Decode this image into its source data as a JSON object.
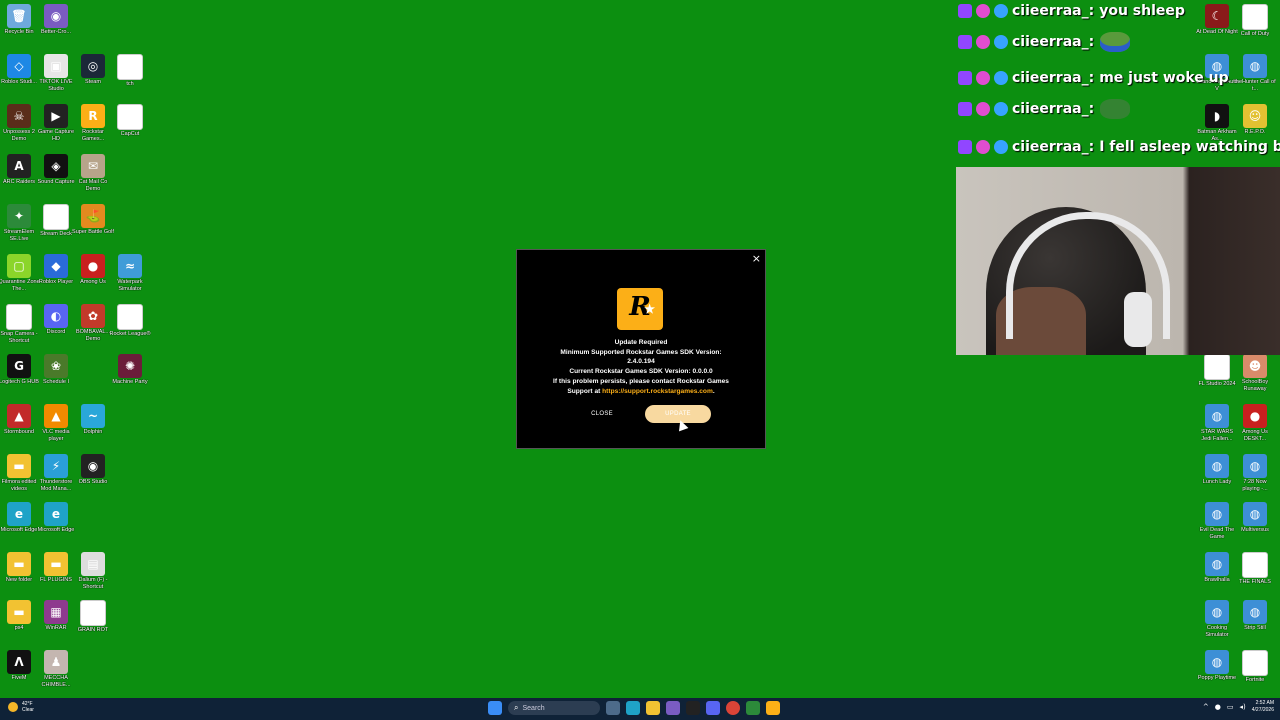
{
  "desktop_icons_left": [
    {
      "label": "Recycle Bin",
      "color": "#6fa9dc",
      "glyph": "🗑"
    },
    {
      "label": "Better-Cro...",
      "color": "#7a5cc2",
      "glyph": "◉"
    },
    {
      "label": "Roblox Studi...",
      "color": "#1e88e5",
      "glyph": "◇"
    },
    {
      "label": "TIKTOK LIVE Studio",
      "color": "#e6e6e6",
      "glyph": "▣"
    },
    {
      "label": "Steam",
      "color": "#1b2838",
      "glyph": "◎"
    },
    {
      "label": "tch",
      "color": "#ffffff",
      "glyph": ""
    },
    {
      "label": "Unpossess 2 Demo",
      "color": "#5a2d1a",
      "glyph": "☠"
    },
    {
      "label": "Game Capture HD",
      "color": "#222",
      "glyph": "▶"
    },
    {
      "label": "Rockstar Games...",
      "color": "#fcaf17",
      "glyph": "R"
    },
    {
      "label": "CapCut",
      "color": "#ffffff",
      "glyph": ""
    },
    {
      "label": "ARC Raiders",
      "color": "#222",
      "glyph": "A"
    },
    {
      "label": "Sound Capture",
      "color": "#111",
      "glyph": "◈"
    },
    {
      "label": "Cat Mail Co Demo",
      "color": "#b7a48a",
      "glyph": "✉"
    },
    {
      "label": "StreamElem SE.Live",
      "color": "#2c8a3a",
      "glyph": "✦"
    },
    {
      "label": "Stream Deck",
      "color": "#ffffff",
      "glyph": ""
    },
    {
      "label": "Super Battle Golf",
      "color": "#e38a1f",
      "glyph": "⛳"
    },
    {
      "label": "Quarantine Zone The...",
      "color": "#8bd52a",
      "glyph": "▢"
    },
    {
      "label": "Roblox Player",
      "color": "#2a6bd9",
      "glyph": "◆"
    },
    {
      "label": "Among Us",
      "color": "#c9201f",
      "glyph": "●"
    },
    {
      "label": "Waterpark Simulator",
      "color": "#3f9cd8",
      "glyph": "≈"
    },
    {
      "label": "Snap Camera - Shortcut",
      "color": "#ffffff",
      "glyph": ""
    },
    {
      "label": "Discord",
      "color": "#5865f2",
      "glyph": "◐"
    },
    {
      "label": "BOMBAVAL... Demo",
      "color": "#c23a2a",
      "glyph": "✿"
    },
    {
      "label": "Rocket League®",
      "color": "#ffffff",
      "glyph": ""
    },
    {
      "label": "Logitech G HUB",
      "color": "#111",
      "glyph": "G"
    },
    {
      "label": "Schedule I",
      "color": "#4a7a2a",
      "glyph": "❀"
    },
    {
      "label": "Machine Party",
      "color": "#6b1d3a",
      "glyph": "✺"
    },
    {
      "label": "Stormbound",
      "color": "#c22a2a",
      "glyph": "▲"
    },
    {
      "label": "VLC media player",
      "color": "#f28a00",
      "glyph": "▲"
    },
    {
      "label": "Dolphin",
      "color": "#2aa7d9",
      "glyph": "~"
    },
    {
      "label": "Filmora edited videos",
      "color": "#f2c232",
      "glyph": "▬"
    },
    {
      "label": "Thunderstore Mod Mana...",
      "color": "#2a9fd8",
      "glyph": "⚡"
    },
    {
      "label": "OBS Studio",
      "color": "#222",
      "glyph": "◉"
    },
    {
      "label": "Microsoft Edge",
      "color": "#1fa3c7",
      "glyph": "e"
    },
    {
      "label": "Microsoft Edge",
      "color": "#1fa3c7",
      "glyph": "e"
    },
    {
      "label": "New folder",
      "color": "#f2c232",
      "glyph": "▬"
    },
    {
      "label": "FL PLUGINS",
      "color": "#f2c232",
      "glyph": "▬"
    },
    {
      "label": "Dalium (F) - Shortcut",
      "color": "#dddddd",
      "glyph": "▤"
    },
    {
      "label": "ps4",
      "color": "#f2c232",
      "glyph": "▬"
    },
    {
      "label": "WinRAR",
      "color": "#8e3a8e",
      "glyph": "▦"
    },
    {
      "label": "GRAIN ROT",
      "color": "#ffffff",
      "glyph": ""
    },
    {
      "label": "FiveM",
      "color": "#111",
      "glyph": "Λ"
    },
    {
      "label": "MECCHA CHIMBLE...",
      "color": "#c4b6b0",
      "glyph": "♟"
    }
  ],
  "desktop_icons_right": [
    {
      "label": "At Dead Of Night",
      "color": "#8a1a1a",
      "glyph": "☾"
    },
    {
      "label": "Call of Duty",
      "color": "#ffffff",
      "glyph": ""
    },
    {
      "label": "Grand Theft Auto V",
      "color": "#3d8fd6",
      "glyph": "◍"
    },
    {
      "label": "theHunter Call of t...",
      "color": "#3d8fd6",
      "glyph": "◍"
    },
    {
      "label": "Batman Arkham As...",
      "color": "#111",
      "glyph": "◗"
    },
    {
      "label": "R.E.P.O.",
      "color": "#e2c132",
      "glyph": "☺"
    },
    {
      "label": "FL Studio 2024",
      "color": "#ffffff",
      "glyph": ""
    },
    {
      "label": "SchoolBoy Runaway",
      "color": "#d98b6a",
      "glyph": "☻"
    },
    {
      "label": "STAR WARS Jedi Fallen...",
      "color": "#3d8fd6",
      "glyph": "◍"
    },
    {
      "label": "Among Us DESKT...",
      "color": "#c9201f",
      "glyph": "●"
    },
    {
      "label": "Lunch Lady",
      "color": "#3d8fd6",
      "glyph": "◍"
    },
    {
      "label": "7:28 Now playing -...",
      "color": "#3d8fd6",
      "glyph": "◍"
    },
    {
      "label": "Evil Dead The Game",
      "color": "#3d8fd6",
      "glyph": "◍"
    },
    {
      "label": "Multiversus",
      "color": "#3d8fd6",
      "glyph": "◍"
    },
    {
      "label": "Brawlhalla",
      "color": "#3d8fd6",
      "glyph": "◍"
    },
    {
      "label": "THE FINALS",
      "color": "#ffffff",
      "glyph": ""
    },
    {
      "label": "Cooking Simulator",
      "color": "#3d8fd6",
      "glyph": "◍"
    },
    {
      "label": "Strip Still",
      "color": "#3d8fd6",
      "glyph": "◍"
    },
    {
      "label": "Poppy Playtime",
      "color": "#3d8fd6",
      "glyph": "◍"
    },
    {
      "label": "Fortnite",
      "color": "#ffffff",
      "glyph": ""
    }
  ],
  "chat": [
    {
      "user": "ciieerraa_:",
      "msg": "you shleep",
      "emote": ""
    },
    {
      "user": "ciieerraa_:",
      "msg": "",
      "emote": "frog"
    },
    {
      "user": "ciieerraa_:",
      "msg": "me just woke up",
      "emote": ""
    },
    {
      "user": "ciieerraa_:",
      "msg": "",
      "emote": "turtle"
    },
    {
      "user": "ciieerraa_:",
      "msg": "I fell asleep watching b",
      "emote": ""
    }
  ],
  "dialog": {
    "close_x": "×",
    "logo_letter": "R",
    "title": "Update Required",
    "line1": "Minimum Supported Rockstar Games SDK Version:",
    "line2": "2.4.0.194",
    "line3": "Current Rockstar Games SDK Version: 0.0.0.0",
    "line4": "If this problem persists, please contact Rockstar Games",
    "line5_prefix": "Support at ",
    "line5_link": "https://support.rockstargames.com",
    "line5_suffix": ".",
    "close_label": "CLOSE",
    "update_label": "UPDATE"
  },
  "taskbar": {
    "weather_temp": "42°F",
    "weather_desc": "Clear",
    "search_placeholder": "Search",
    "time": "2:52 AM",
    "date": "4/27/2026"
  }
}
